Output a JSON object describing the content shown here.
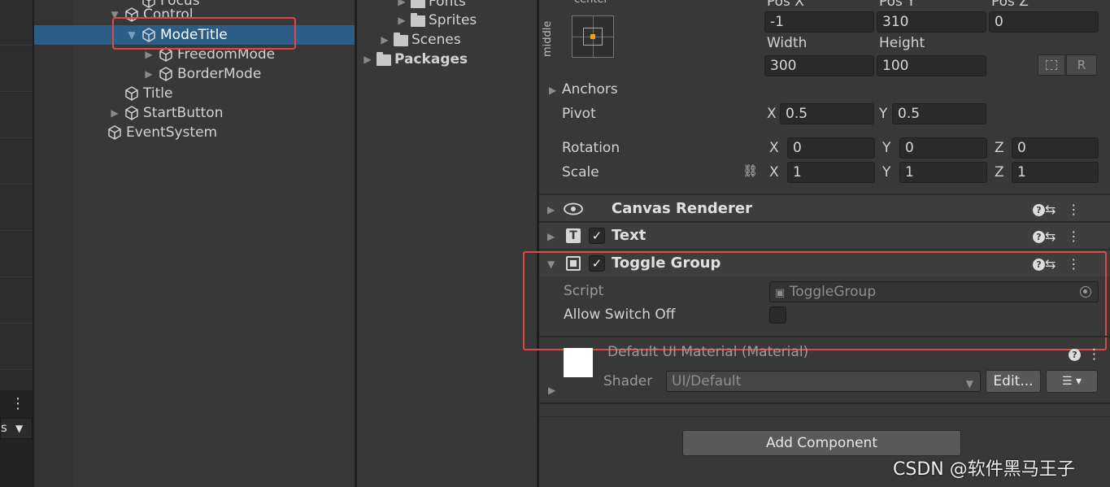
{
  "hierarchy": {
    "items": [
      {
        "label": "Focus"
      },
      {
        "label": "Control"
      },
      {
        "label": "ModeTitle"
      },
      {
        "label": "FreedomMode"
      },
      {
        "label": "BorderMode"
      },
      {
        "label": "Title"
      },
      {
        "label": "StartButton"
      },
      {
        "label": "EventSystem"
      }
    ]
  },
  "project": {
    "items": [
      {
        "label": "Fonts"
      },
      {
        "label": "Sprites"
      },
      {
        "label": "Scenes"
      },
      {
        "label": "Packages"
      }
    ]
  },
  "rect_transform": {
    "anchor_preset_top": "center",
    "anchor_preset_side": "middle",
    "pos_x_label": "Pos X",
    "pos_y_label": "Pos Y",
    "pos_z_label": "Pos Z",
    "pos_x": "-1",
    "pos_y": "310",
    "pos_z": "0",
    "width_label": "Width",
    "height_label": "Height",
    "width": "300",
    "height": "100",
    "r_button": "R",
    "anchors_label": "Anchors",
    "pivot_label": "Pivot",
    "pivot_x_label": "X",
    "pivot_x": "0.5",
    "pivot_y_label": "Y",
    "pivot_y": "0.5",
    "rotation_label": "Rotation",
    "rot_x_label": "X",
    "rot_x": "0",
    "rot_y_label": "Y",
    "rot_y": "0",
    "rot_z_label": "Z",
    "rot_z": "0",
    "scale_label": "Scale",
    "scale_x_label": "X",
    "scale_x": "1",
    "scale_y_label": "Y",
    "scale_y": "1",
    "scale_z_label": "Z",
    "scale_z": "1"
  },
  "components": {
    "canvas_renderer": "Canvas Renderer",
    "text": "Text",
    "text_icon": "T",
    "toggle_group": "Toggle Group",
    "script_label": "Script",
    "script_value": "ToggleGroup",
    "allow_switch_off_label": "Allow Switch Off"
  },
  "material": {
    "title": "Default UI Material (Material)",
    "shader_label": "Shader",
    "shader_value": "UI/Default",
    "edit_button": "Edit..."
  },
  "add_component_button": "Add Component",
  "watermark": "CSDN @软件黑马王子",
  "left_strip": {
    "cut_text": "s"
  },
  "colors": {
    "selection": "#2c5d87",
    "highlight": "#e04848"
  }
}
